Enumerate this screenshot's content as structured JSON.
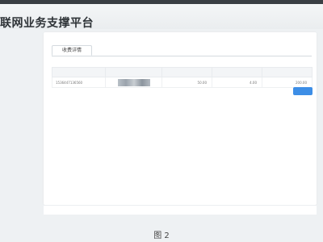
{
  "header": {
    "title": "联网业务支撑平台"
  },
  "main": {
    "tab_label": "收费详情",
    "table": {
      "columns": [
        "",
        "",
        "",
        "",
        ""
      ],
      "rows": [
        {
          "number": "1536447136560",
          "name": "",
          "price": "50.00",
          "quantity": "4.00",
          "total": "200.00"
        }
      ]
    },
    "confirm_label": ""
  },
  "footer": {
    "left": "",
    "right": ""
  },
  "caption": "图 2",
  "colors": {
    "topbar": "#3a3f44",
    "accent": "#3d8ee6",
    "background": "#eef1f3"
  }
}
